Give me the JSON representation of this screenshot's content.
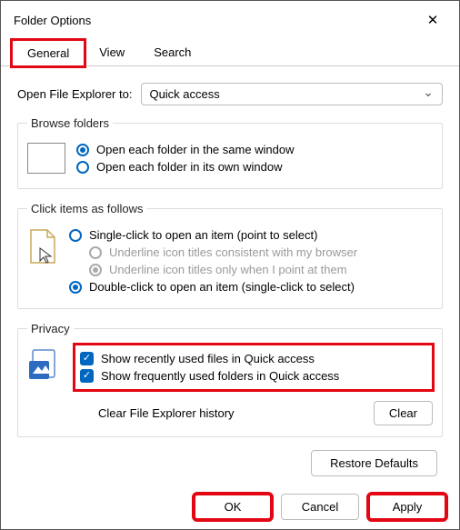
{
  "window": {
    "title": "Folder Options",
    "close": "✕"
  },
  "tabs": {
    "general": "General",
    "view": "View",
    "search": "Search"
  },
  "openExplorer": {
    "label": "Open File Explorer to:",
    "value": "Quick access"
  },
  "browseFolders": {
    "legend": "Browse folders",
    "sameWindow": "Open each folder in the same window",
    "ownWindow": "Open each folder in its own window"
  },
  "clickItems": {
    "legend": "Click items as follows",
    "single": "Single-click to open an item (point to select)",
    "underlineBrowser": "Underline icon titles consistent with my browser",
    "underlinePoint": "Underline icon titles only when I point at them",
    "double": "Double-click to open an item (single-click to select)"
  },
  "privacy": {
    "legend": "Privacy",
    "recent": "Show recently used files in Quick access",
    "frequent": "Show frequently used folders in Quick access",
    "clearLabel": "Clear File Explorer history",
    "clearBtn": "Clear"
  },
  "restore": "Restore Defaults",
  "footer": {
    "ok": "OK",
    "cancel": "Cancel",
    "apply": "Apply"
  }
}
